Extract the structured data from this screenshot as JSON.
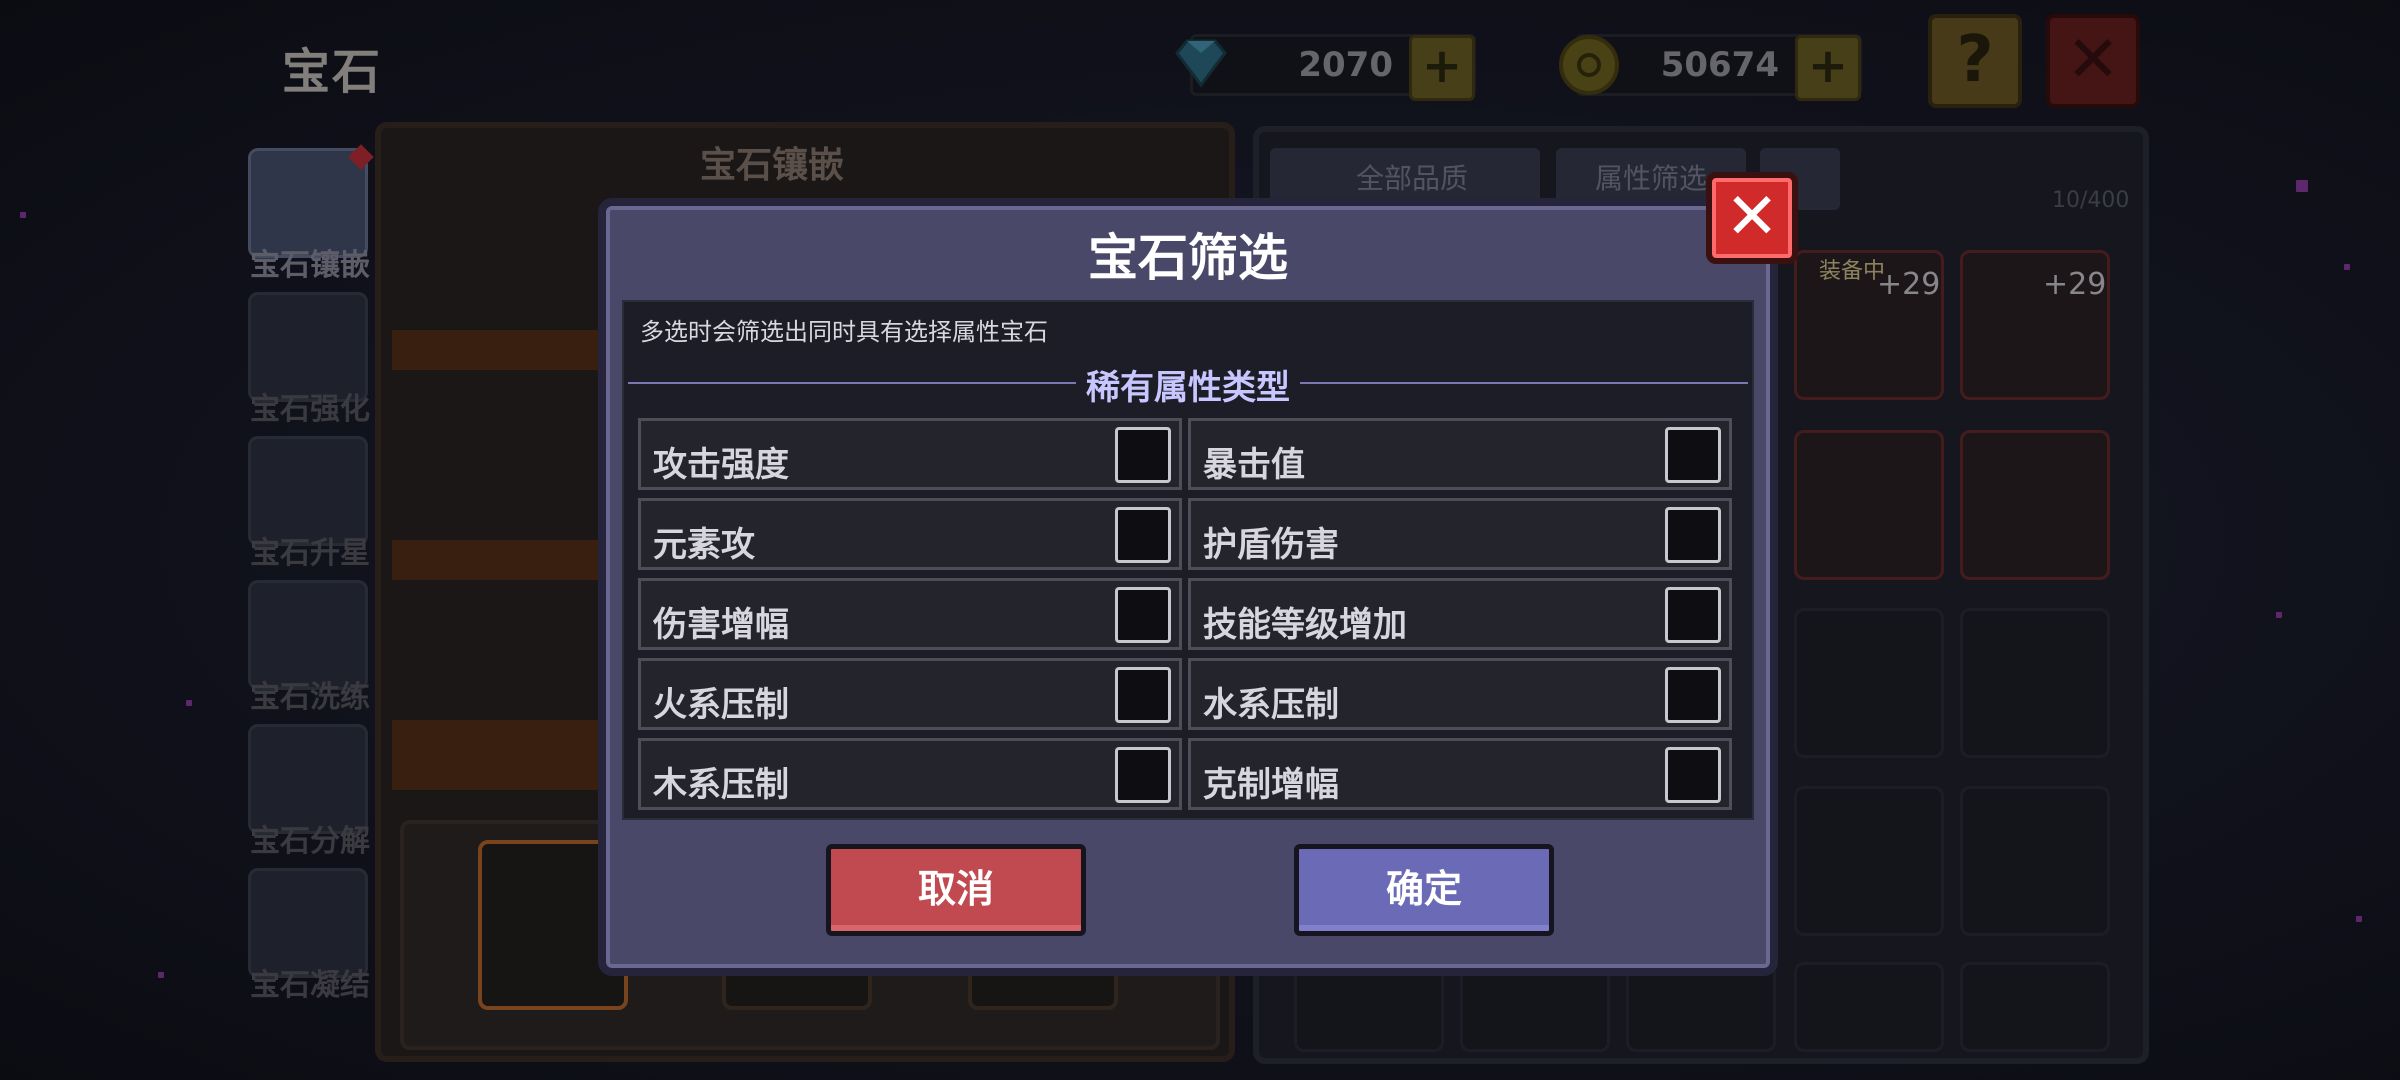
{
  "header": {
    "title": "宝石",
    "gems": "2070",
    "coins": "50674",
    "help_icon": "?",
    "close_icon": "✕"
  },
  "sidebar": {
    "items": [
      {
        "label": "宝石镶嵌",
        "active": true
      },
      {
        "label": "宝石强化"
      },
      {
        "label": "宝石升星"
      },
      {
        "label": "宝石洗练"
      },
      {
        "label": "宝石分解"
      },
      {
        "label": "宝石凝结"
      }
    ]
  },
  "center": {
    "title": "宝石镶嵌"
  },
  "inventory": {
    "quality_filter": "全部品质",
    "attr_filter": "属性筛选",
    "count": "10/400",
    "equipped_label": "装备中",
    "plus_a": "+29",
    "plus_b": "+29"
  },
  "modal": {
    "title": "宝石筛选",
    "hint": "多选时会筛选出同时具有选择属性宝石",
    "section_title": "稀有属性类型",
    "options": [
      {
        "label": "攻击强度",
        "checked": false
      },
      {
        "label": "暴击值",
        "checked": false
      },
      {
        "label": "元素攻",
        "checked": false
      },
      {
        "label": "护盾伤害",
        "checked": false
      },
      {
        "label": "伤害增幅",
        "checked": false
      },
      {
        "label": "技能等级增加",
        "checked": false
      },
      {
        "label": "火系压制",
        "checked": false
      },
      {
        "label": "水系压制",
        "checked": false
      },
      {
        "label": "木系压制",
        "checked": false
      },
      {
        "label": "克制增幅",
        "checked": false
      }
    ],
    "cancel": "取消",
    "confirm": "确定",
    "close_icon": "✕"
  },
  "colors": {
    "modal_bg": "#4a4868",
    "cancel": "#c04a4f",
    "confirm": "#6a6ab6",
    "close": "#d12a2a"
  }
}
